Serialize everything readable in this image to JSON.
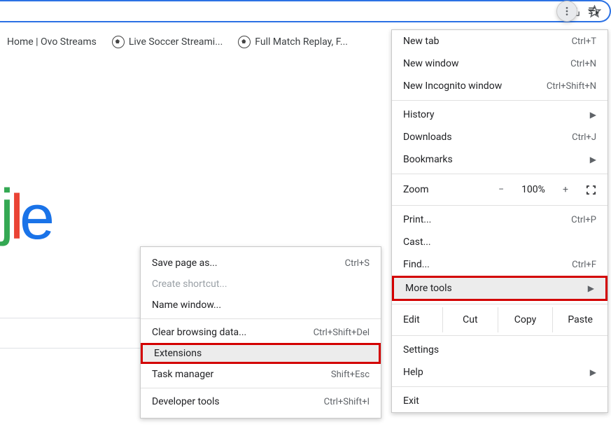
{
  "bookmarks": [
    {
      "label": "Home | Ovo Streams"
    },
    {
      "label": "Live Soccer Streami...",
      "icon": "soccer"
    },
    {
      "label": "Full Match Replay, F...",
      "icon": "soccer"
    }
  ],
  "logo": {
    "c1": "j",
    "c2": "l",
    "c3": "e"
  },
  "mainMenu": {
    "newTab": {
      "label": "New tab",
      "short": "Ctrl+T"
    },
    "newWin": {
      "label": "New window",
      "short": "Ctrl+N"
    },
    "newInc": {
      "label": "New Incognito window",
      "short": "Ctrl+Shift+N"
    },
    "history": {
      "label": "History"
    },
    "downloads": {
      "label": "Downloads",
      "short": "Ctrl+J"
    },
    "bookmarks": {
      "label": "Bookmarks"
    },
    "zoom": {
      "label": "Zoom",
      "value": "100%",
      "minus": "−",
      "plus": "+"
    },
    "print": {
      "label": "Print...",
      "short": "Ctrl+P"
    },
    "cast": {
      "label": "Cast..."
    },
    "find": {
      "label": "Find...",
      "short": "Ctrl+F"
    },
    "moreTools": {
      "label": "More tools"
    },
    "edit": {
      "label": "Edit",
      "cut": "Cut",
      "copy": "Copy",
      "paste": "Paste"
    },
    "settings": {
      "label": "Settings"
    },
    "help": {
      "label": "Help"
    },
    "exit": {
      "label": "Exit"
    }
  },
  "subMenu": {
    "savePage": {
      "label": "Save page as...",
      "short": "Ctrl+S"
    },
    "createShortcut": {
      "label": "Create shortcut..."
    },
    "nameWindow": {
      "label": "Name window..."
    },
    "clearData": {
      "label": "Clear browsing data...",
      "short": "Ctrl+Shift+Del"
    },
    "extensions": {
      "label": "Extensions"
    },
    "taskMgr": {
      "label": "Task manager",
      "short": "Shift+Esc"
    },
    "devTools": {
      "label": "Developer tools",
      "short": "Ctrl+Shift+I"
    }
  }
}
